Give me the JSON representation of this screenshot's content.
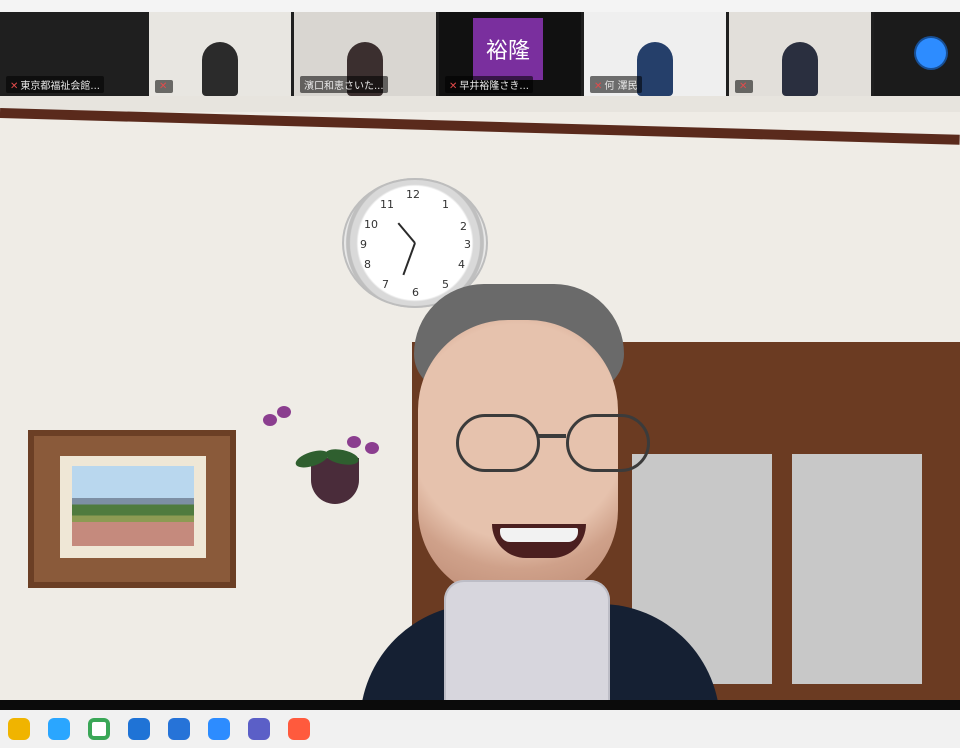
{
  "participants": [
    {
      "name": "東京都福祉会館..."
    },
    {
      "name": ""
    },
    {
      "name": "濱口和恵さいた..."
    },
    {
      "name": "早井裕隆さき...",
      "avatar_text": "裕隆"
    },
    {
      "name": "何 澤民"
    },
    {
      "name": ""
    }
  ],
  "main_video": {
    "speaker": "main-speaker",
    "clock_numbers": [
      "12",
      "1",
      "2",
      "3",
      "4",
      "5",
      "6",
      "7",
      "8",
      "9",
      "10",
      "11"
    ]
  },
  "taskbar": {
    "icons": [
      {
        "name": "file-explorer-icon"
      },
      {
        "name": "edge-icon"
      },
      {
        "name": "chrome-icon"
      },
      {
        "name": "outlook-icon"
      },
      {
        "name": "store-icon"
      },
      {
        "name": "zoom-icon"
      },
      {
        "name": "teams-icon"
      },
      {
        "name": "photos-icon"
      }
    ]
  },
  "colors": {
    "accent": "#2d8cff",
    "mic_muted": "#e34b4b",
    "avatar_bg": "#7a2f9e"
  }
}
